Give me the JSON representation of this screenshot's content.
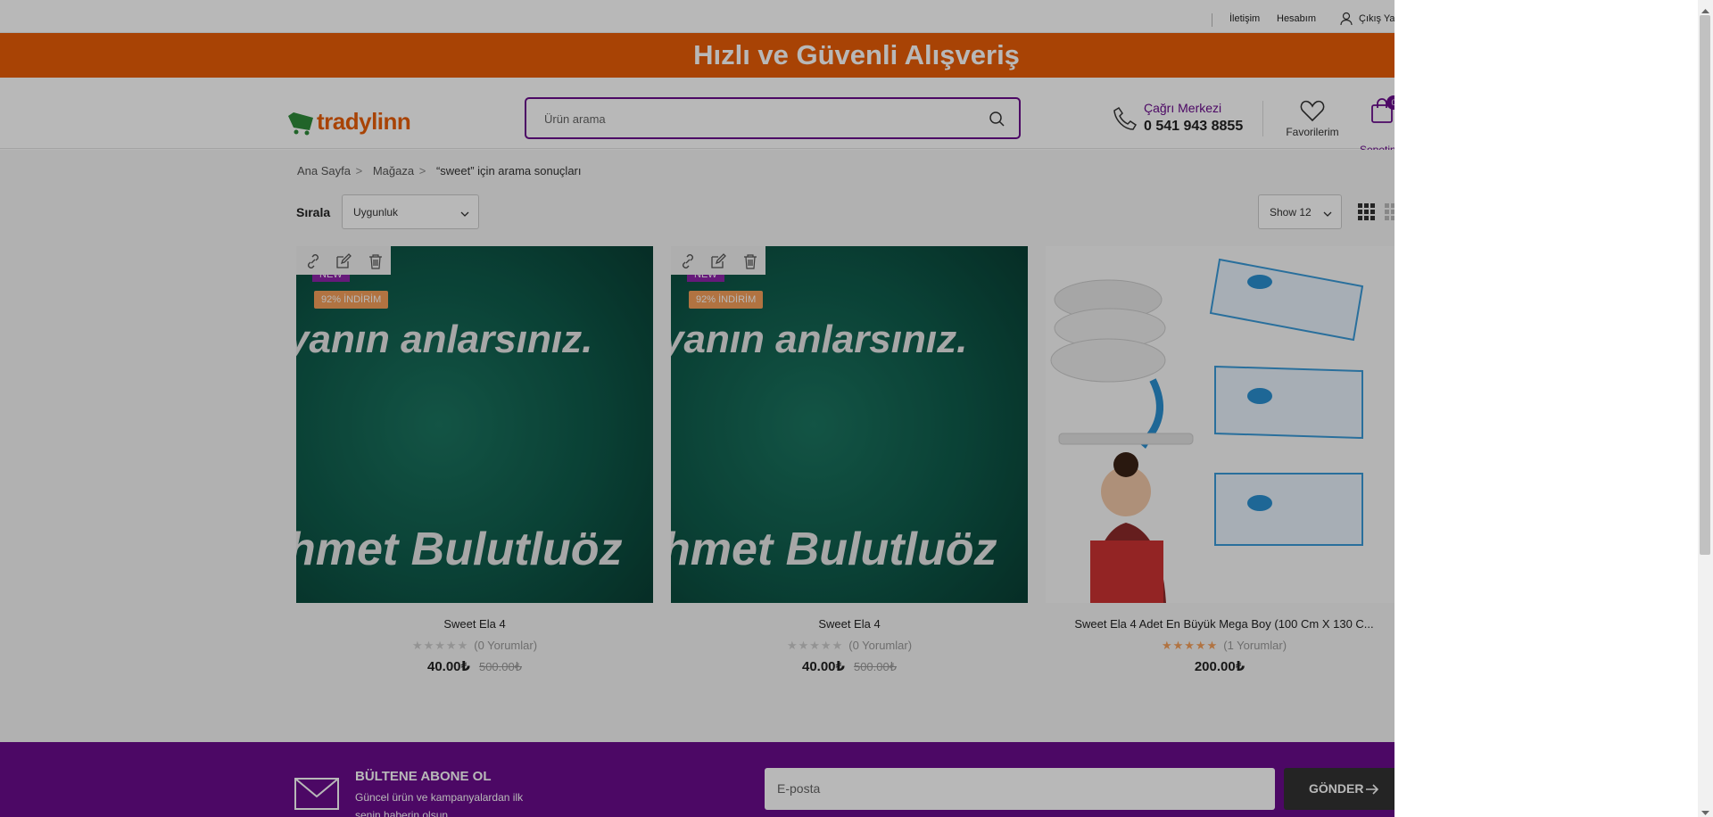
{
  "topbar": {
    "contact": "İletişim",
    "account": "Hesabım",
    "logout": "Çıkış Ya"
  },
  "banner": {
    "text": "Hızlı ve Güvenli Alışveriş"
  },
  "header": {
    "logo_text": "tradylinn",
    "search_placeholder": "Ürün arama",
    "call_label": "Çağrı Merkezi",
    "call_number": "0 541 943 8855",
    "favorites_label": "Favorilerim",
    "cart_label": "Sepetin",
    "cart_count": "0"
  },
  "breadcrumb": {
    "home": "Ana Sayfa",
    "sep": ">",
    "store": "Mağaza",
    "current": "“sweet” için arama sonuçları"
  },
  "toolbar": {
    "sort_label": "Sırala",
    "sort_value": "Uygunluk",
    "show_value": "Show 12"
  },
  "products": [
    {
      "title": "Sweet Ela 4",
      "reviews": "(0 Yorumlar)",
      "stars": "★★★★★",
      "price": "40.00₺",
      "old_price": "500.00₺",
      "new_badge": "NEW",
      "discount_badge": "92% İNDİRİM",
      "image_text_1": "yanın anlarsınız.",
      "image_text_2": "hmet Bulutluöz"
    },
    {
      "title": "Sweet Ela 4",
      "reviews": "(0 Yorumlar)",
      "stars": "★★★★★",
      "price": "40.00₺",
      "old_price": "500.00₺",
      "new_badge": "NEW",
      "discount_badge": "92% İNDİRİM",
      "image_text_1": "yanın anlarsınız.",
      "image_text_2": "hmet Bulutluöz"
    },
    {
      "title": "Sweet Ela 4 Adet En Büyük Mega Boy (100 Cm X 130 C...",
      "reviews": "(1 Yorumlar)",
      "stars": "★★★★★",
      "price": "200.00₺"
    }
  ],
  "newsletter": {
    "title": "BÜLTENE ABONE OL",
    "desc": "Güncel ürün ve kampanyalardan ilk senin haberin olsun.",
    "email_placeholder": "E-posta",
    "send_label": "GÖNDER"
  },
  "colors": {
    "brand_orange": "#e95e08",
    "brand_purple": "#6a0c8c",
    "star_filled": "#f5a05a",
    "star_empty": "#cccccc"
  }
}
